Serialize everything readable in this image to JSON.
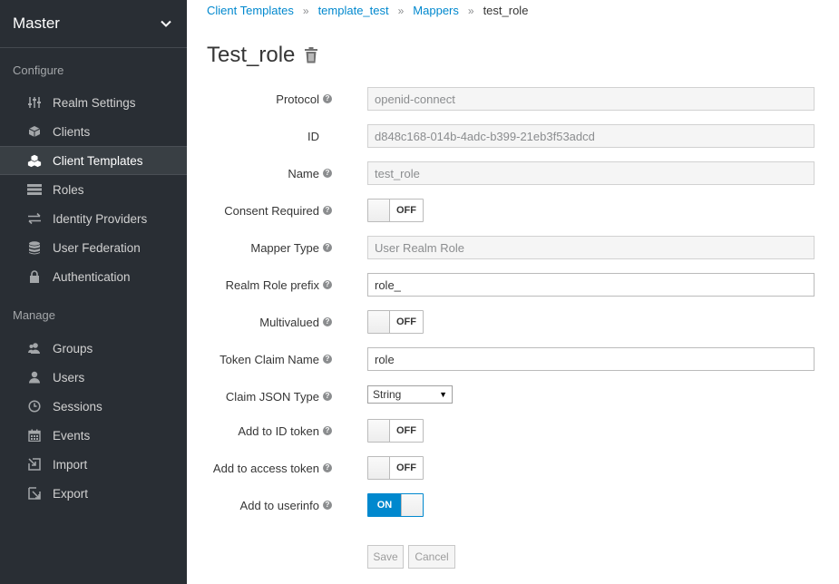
{
  "sidebar": {
    "realm": "Master",
    "configure_label": "Configure",
    "manage_label": "Manage",
    "configure_items": [
      {
        "label": "Realm Settings"
      },
      {
        "label": "Clients"
      },
      {
        "label": "Client Templates"
      },
      {
        "label": "Roles"
      },
      {
        "label": "Identity Providers"
      },
      {
        "label": "User Federation"
      },
      {
        "label": "Authentication"
      }
    ],
    "manage_items": [
      {
        "label": "Groups"
      },
      {
        "label": "Users"
      },
      {
        "label": "Sessions"
      },
      {
        "label": "Events"
      },
      {
        "label": "Import"
      },
      {
        "label": "Export"
      }
    ]
  },
  "breadcrumb": {
    "items": [
      "Client Templates",
      "template_test",
      "Mappers"
    ],
    "current": "test_role",
    "separator": "»"
  },
  "page": {
    "title": "Test_role"
  },
  "form": {
    "protocol": {
      "label": "Protocol",
      "value": "openid-connect"
    },
    "id": {
      "label": "ID",
      "value": "d848c168-014b-4adc-b399-21eb3f53adcd"
    },
    "name": {
      "label": "Name",
      "value": "test_role"
    },
    "consent_required": {
      "label": "Consent Required",
      "state": "OFF"
    },
    "mapper_type": {
      "label": "Mapper Type",
      "value": "User Realm Role"
    },
    "realm_role_prefix": {
      "label": "Realm Role prefix",
      "value": "role_"
    },
    "multivalued": {
      "label": "Multivalued",
      "state": "OFF"
    },
    "token_claim_name": {
      "label": "Token Claim Name",
      "value": "role"
    },
    "claim_json_type": {
      "label": "Claim JSON Type",
      "value": "String"
    },
    "add_to_id_token": {
      "label": "Add to ID token",
      "state": "OFF"
    },
    "add_to_access_token": {
      "label": "Add to access token",
      "state": "OFF"
    },
    "add_to_userinfo": {
      "label": "Add to userinfo",
      "state": "ON"
    },
    "help_glyph": "?"
  },
  "buttons": {
    "save": "Save",
    "cancel": "Cancel"
  },
  "colors": {
    "sidebar_bg": "#292e34",
    "accent": "#0088ce"
  }
}
